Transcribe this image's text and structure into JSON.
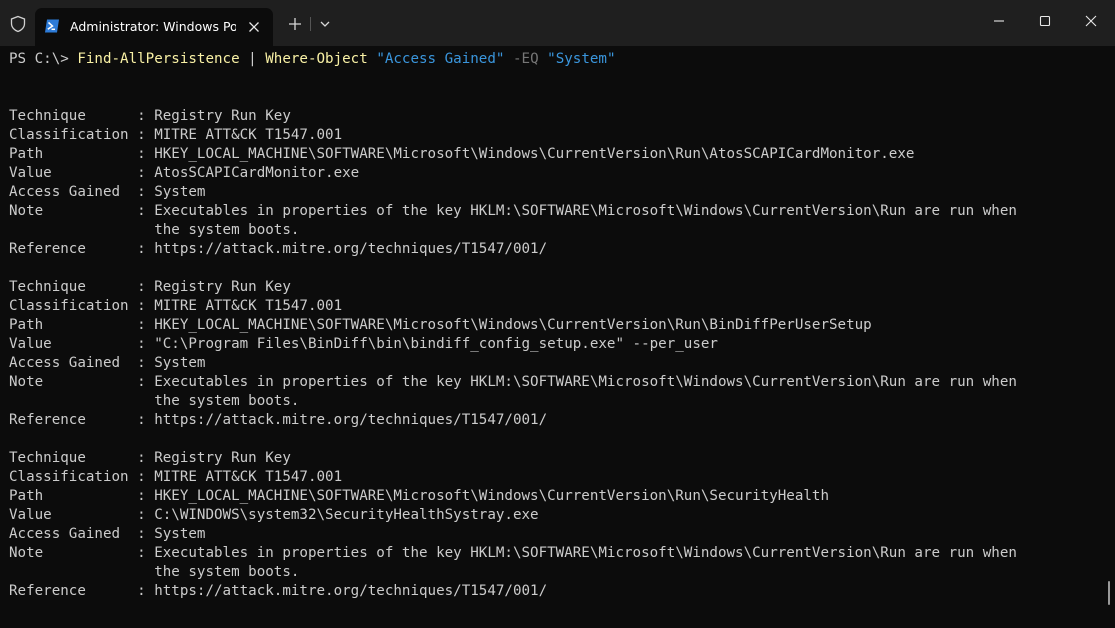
{
  "window": {
    "tab_title": "Administrator: Windows PowerShell"
  },
  "prompt": {
    "prefix": "PS C:\\> ",
    "command": "Find-AllPersistence",
    "pipe": " | ",
    "cmdlet": "Where-Object",
    "arg1": "\"Access Gained\"",
    "param": "-EQ",
    "arg2": "\"System\""
  },
  "labels": {
    "technique": "Technique      : ",
    "classification": "Classification : ",
    "path": "Path           : ",
    "value": "Value          : ",
    "access": "Access Gained  : ",
    "note": "Note           : ",
    "note_cont": "                 ",
    "reference": "Reference      : "
  },
  "results": [
    {
      "technique": "Registry Run Key",
      "classification": "MITRE ATT&CK T1547.001",
      "path": "HKEY_LOCAL_MACHINE\\SOFTWARE\\Microsoft\\Windows\\CurrentVersion\\Run\\AtosSCAPICardMonitor.exe",
      "value": "AtosSCAPICardMonitor.exe",
      "access_gained": "System",
      "note_line1": "Executables in properties of the key HKLM:\\SOFTWARE\\Microsoft\\Windows\\CurrentVersion\\Run are run when",
      "note_line2": "the system boots.",
      "reference": "https://attack.mitre.org/techniques/T1547/001/"
    },
    {
      "technique": "Registry Run Key",
      "classification": "MITRE ATT&CK T1547.001",
      "path": "HKEY_LOCAL_MACHINE\\SOFTWARE\\Microsoft\\Windows\\CurrentVersion\\Run\\BinDiffPerUserSetup",
      "value": "\"C:\\Program Files\\BinDiff\\bin\\bindiff_config_setup.exe\" --per_user",
      "access_gained": "System",
      "note_line1": "Executables in properties of the key HKLM:\\SOFTWARE\\Microsoft\\Windows\\CurrentVersion\\Run are run when",
      "note_line2": "the system boots.",
      "reference": "https://attack.mitre.org/techniques/T1547/001/"
    },
    {
      "technique": "Registry Run Key",
      "classification": "MITRE ATT&CK T1547.001",
      "path": "HKEY_LOCAL_MACHINE\\SOFTWARE\\Microsoft\\Windows\\CurrentVersion\\Run\\SecurityHealth",
      "value": "C:\\WINDOWS\\system32\\SecurityHealthSystray.exe",
      "access_gained": "System",
      "note_line1": "Executables in properties of the key HKLM:\\SOFTWARE\\Microsoft\\Windows\\CurrentVersion\\Run are run when",
      "note_line2": "the system boots.",
      "reference": "https://attack.mitre.org/techniques/T1547/001/"
    }
  ],
  "colors": {
    "background": "#0c0c0c",
    "titlebar": "#1f1f1f",
    "text": "#cccccc",
    "command": "#f9f1a5",
    "string": "#3a96dd",
    "parameter": "#767676"
  },
  "icons": {
    "shield": "shield-icon",
    "tab": "powershell-icon",
    "close_tab": "close-icon",
    "new_tab": "plus-icon",
    "dropdown": "chevron-down-icon",
    "minimize": "minimize-icon",
    "maximize": "maximize-icon",
    "close": "close-icon"
  }
}
